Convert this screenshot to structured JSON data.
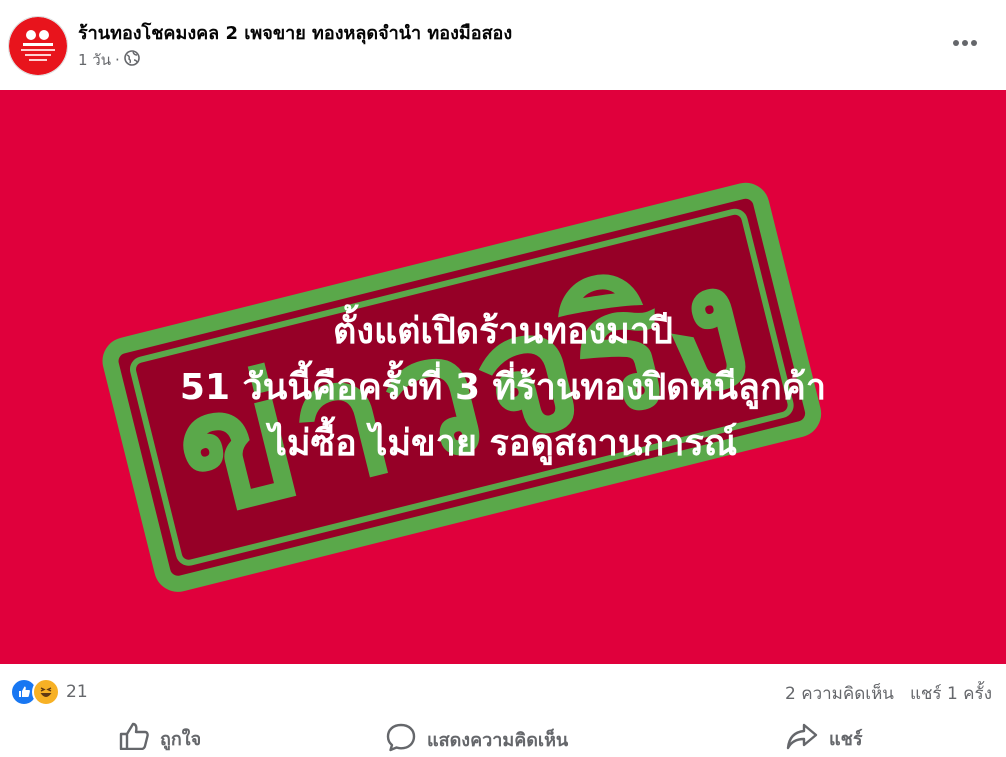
{
  "post": {
    "page_name": "ร้านทองโชคมงคล 2 เพจขาย ทองหลุดจำนำ ทองมือสอง",
    "time": "1 วัน",
    "separator": "·",
    "privacy_icon": "globe-icon",
    "more_icon": "more-horizontal-icon"
  },
  "image": {
    "stamp_text": "ข่าวจริง",
    "headline_lines": [
      "ตั้งแต่เปิดร้านทองมาปี",
      "51 วันนี้คือครั้งที่ 3 ที่ร้านทองปิดหนีลูกค้า",
      "ไม่ซื้อ ไม่ขาย รอดูสถานการณ์"
    ],
    "background_color": "#e0003c",
    "stamp_color": "#5aa84a",
    "stamp_fill": "#960027"
  },
  "stats": {
    "reaction_icons": [
      "like-icon",
      "haha-icon"
    ],
    "reaction_count": "21",
    "comments": "2 ความคิดเห็น",
    "shares": "แชร์ 1 ครั้ง"
  },
  "actions": {
    "like": "ถูกใจ",
    "comment": "แสดงความคิดเห็น",
    "share": "แชร์"
  }
}
